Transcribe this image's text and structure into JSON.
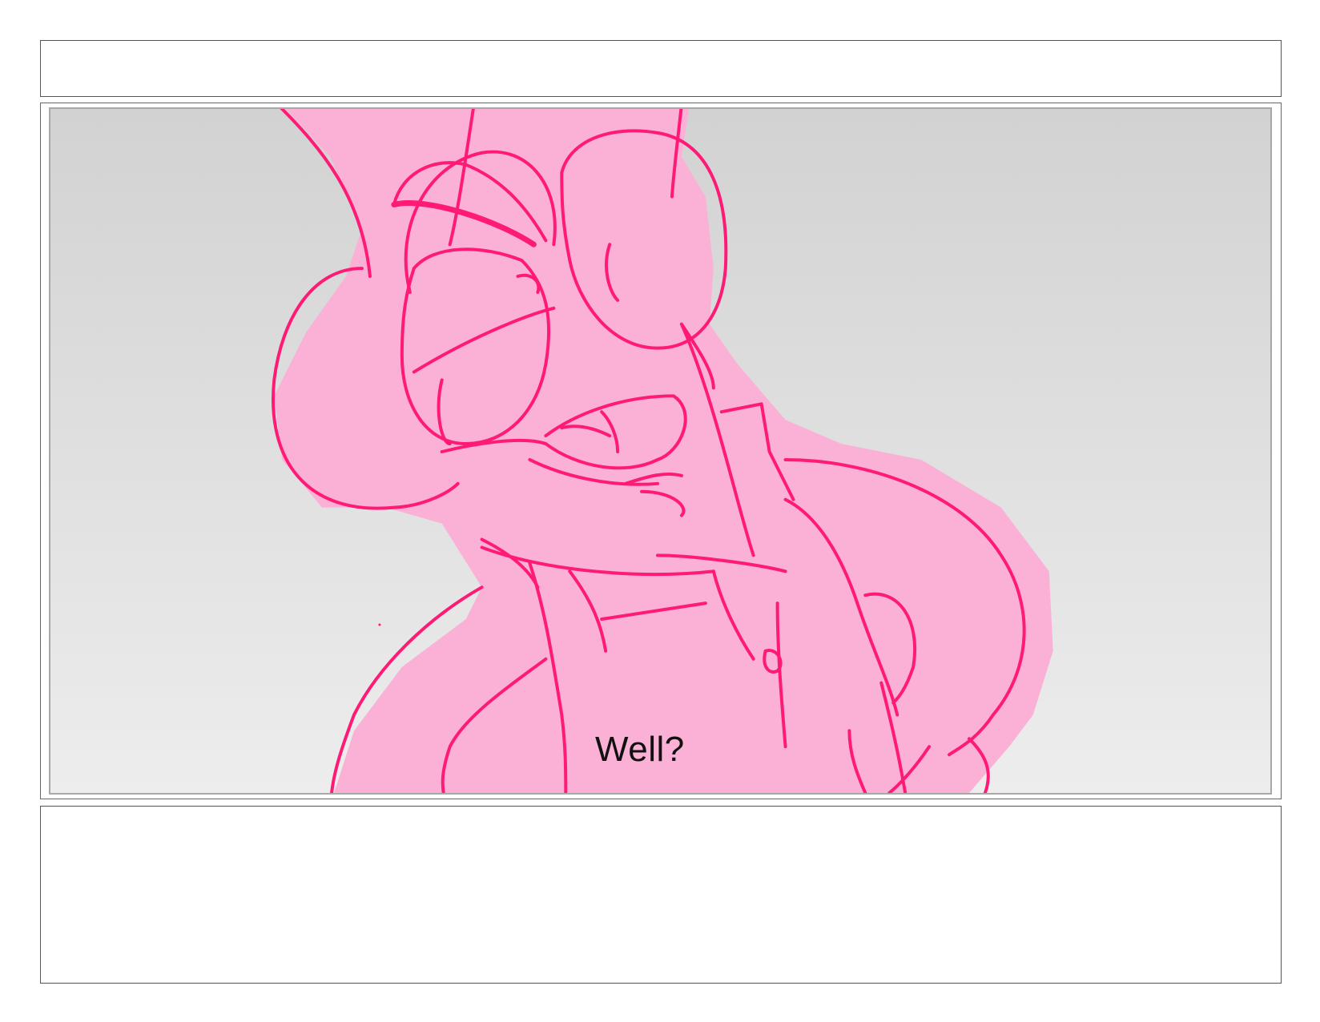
{
  "page": {
    "header_text": "",
    "notes_text": ""
  },
  "panel": {
    "dialogue": "Well?",
    "colors": {
      "line": "#ff1a75",
      "fill": "#fbb1d5",
      "background_top": "#d2d2d2",
      "background_bottom": "#ededed"
    }
  }
}
